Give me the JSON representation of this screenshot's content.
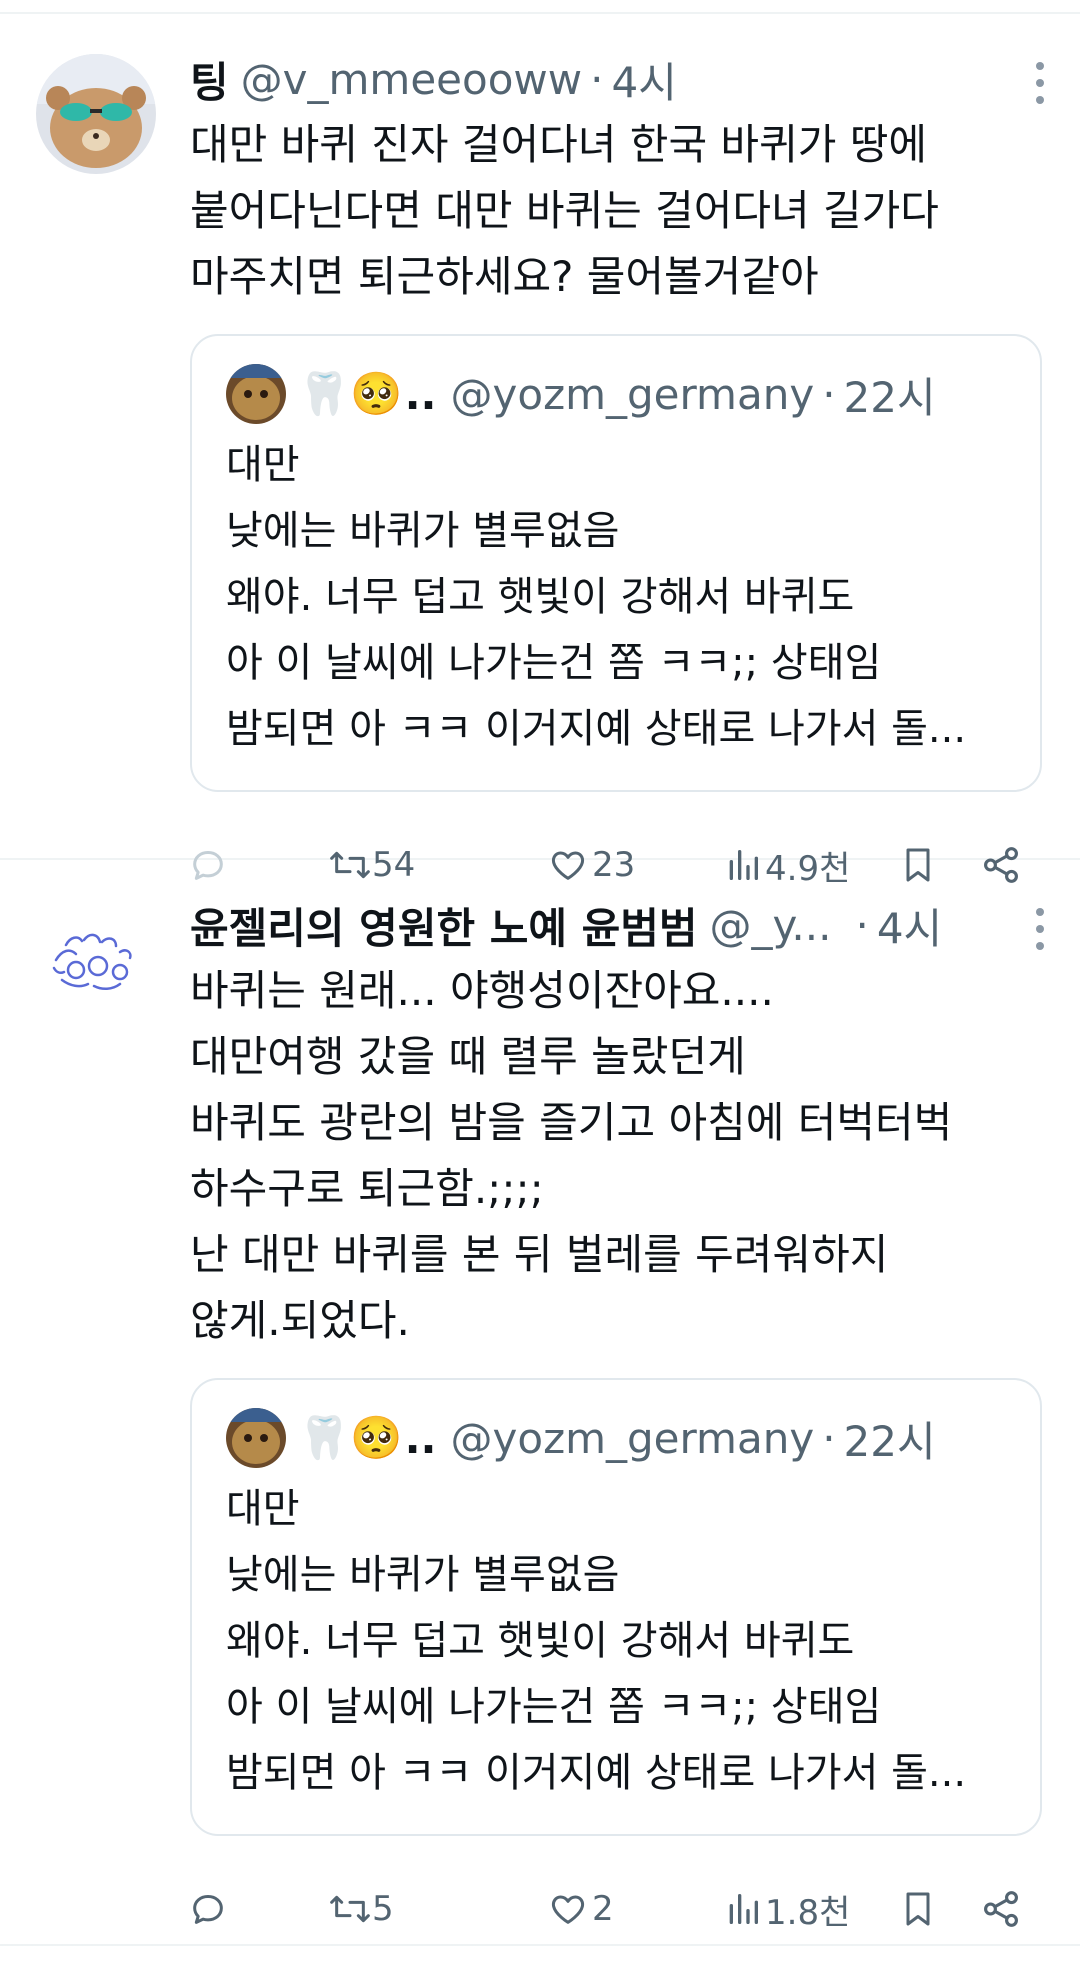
{
  "tweets": [
    {
      "name": "팅",
      "handle": "@v_mmeeooww",
      "dot": "·",
      "time": "4시",
      "text": "대만 바퀴 진자 걸어다녀 한국 바퀴가 땅에\n붙어다닌다면 대만 바퀴는 걸어다녀 길가다\n마주치면 퇴근하세요? 물어볼거같아",
      "quote": {
        "emoji": "🦷🥺",
        "name_tail": "..",
        "handle": "@yozm_germany",
        "dot": "·",
        "time": "22시",
        "text": "대만\n낮에는 바퀴가 별루없음\n왜야. 너무 덥고 햇빛이 강해서 바퀴도\n아 이 날씨에 나가는건 쫌 ㅋㅋ;; 상태임\n밤되면 아 ㅋㅋ 이거지예 상태로 나가서 돌..."
      },
      "stats": {
        "reply": "",
        "retweet": "54",
        "like": "23",
        "views": "4.9천"
      }
    },
    {
      "name": "윤젤리의 영원한 노예 윤범범",
      "handle": "@_y...",
      "dot": "·",
      "time": "4시",
      "text": "바퀴는 원래... 야행성이잔아요....\n대만여행 갔을 때 렬루 놀랐던게\n바퀴도 광란의 밤을 즐기고 아침에 터벅터벅\n하수구로 퇴근함.;;;;\n난 대만 바퀴를 본 뒤 벌레를 두려워하지\n않게.되었다.",
      "quote": {
        "emoji": "🦷🥺",
        "name_tail": "..",
        "handle": "@yozm_germany",
        "dot": "·",
        "time": "22시",
        "text": "대만\n낮에는 바퀴가 별루없음\n왜야. 너무 덥고 햇빛이 강해서 바퀴도\n아 이 날씨에 나가는건 쫌 ㅋㅋ;; 상태임\n밤되면 아 ㅋㅋ 이거지예 상태로 나가서 돌..."
      },
      "stats": {
        "reply": "",
        "retweet": "5",
        "like": "2",
        "views": "1.8천"
      }
    }
  ],
  "icons": {
    "more": "more-vertical-icon",
    "reply": "reply-icon",
    "retweet": "retweet-icon",
    "like": "heart-icon",
    "views": "views-chart-icon",
    "bookmark": "bookmark-icon",
    "share": "share-icon"
  },
  "colors": {
    "text": "#0f1419",
    "secondary": "#536471",
    "border": "#e1e8ed",
    "disabled_reply": "#c4cfd6"
  }
}
